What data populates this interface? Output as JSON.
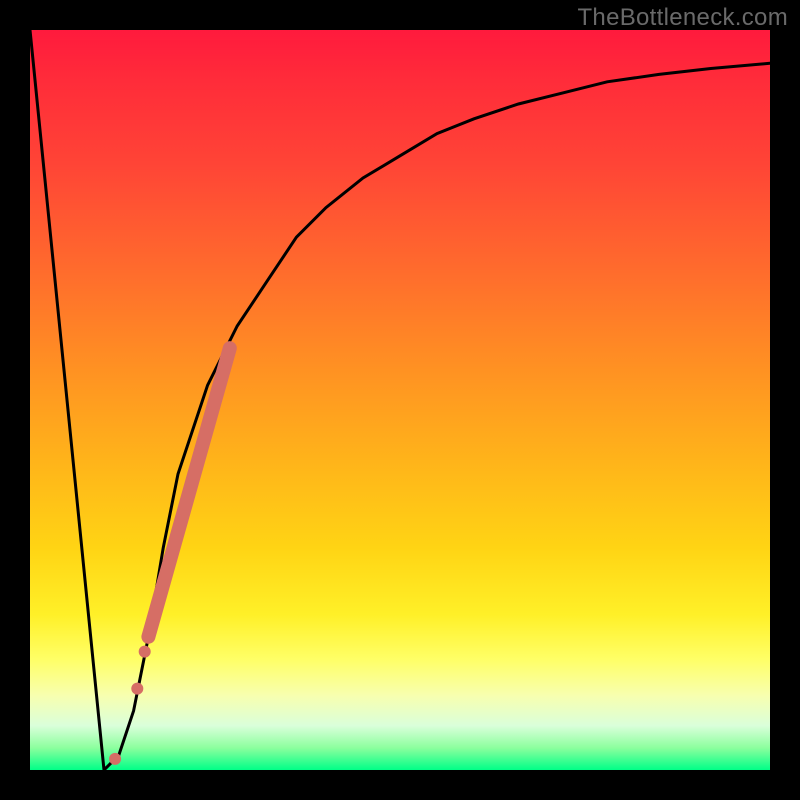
{
  "watermark": {
    "text": "TheBottleneck.com"
  },
  "chart_data": {
    "type": "line",
    "title": "",
    "xlabel": "",
    "ylabel": "",
    "x": [
      0.0,
      0.02,
      0.05,
      0.08,
      0.1,
      0.12,
      0.14,
      0.16,
      0.18,
      0.2,
      0.24,
      0.28,
      0.32,
      0.36,
      0.4,
      0.45,
      0.5,
      0.55,
      0.6,
      0.66,
      0.72,
      0.78,
      0.85,
      0.92,
      1.0
    ],
    "values": [
      100,
      80,
      50,
      20,
      0,
      2,
      8,
      18,
      30,
      40,
      52,
      60,
      66,
      72,
      76,
      80,
      83,
      86,
      88,
      90,
      91.5,
      93,
      94,
      94.8,
      95.5
    ],
    "ylim": [
      0,
      100
    ],
    "xlim": [
      0,
      1
    ],
    "highlight_segment": {
      "x": [
        0.16,
        0.27
      ],
      "values": [
        18,
        57
      ]
    },
    "highlight_points": [
      {
        "x": 0.115,
        "y": 1.5
      },
      {
        "x": 0.145,
        "y": 11
      },
      {
        "x": 0.155,
        "y": 16
      }
    ]
  },
  "colors": {
    "curve": "#000000",
    "highlight": "#d66e65"
  }
}
